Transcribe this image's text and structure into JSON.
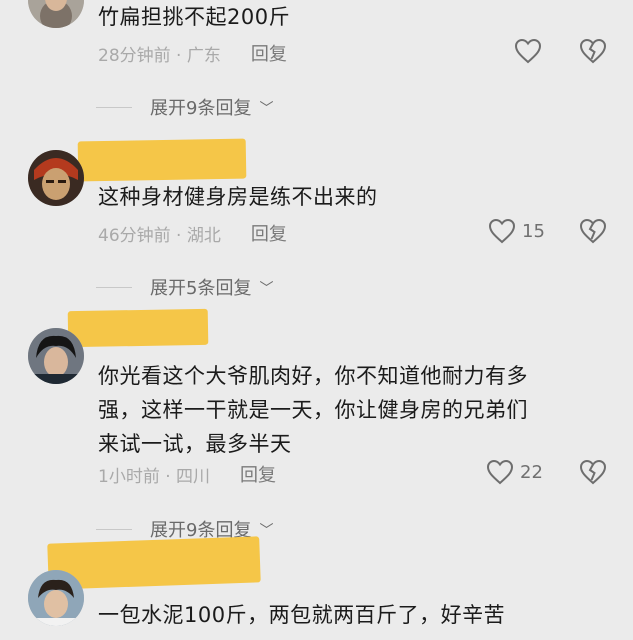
{
  "comments": [
    {
      "text": "竹扁担挑不起200斤",
      "time": "28分钟前 · 广东",
      "reply": "回复",
      "likes": "",
      "expand": "展开9条回复"
    },
    {
      "text": "这种身材健身房是练不出来的",
      "time": "46分钟前 · 湖北",
      "reply": "回复",
      "likes": "15",
      "expand": "展开5条回复"
    },
    {
      "text_lines": [
        "你光看这个大爷肌肉好，你不知道他耐力有多",
        "强，这样一干就是一天，你让健身房的兄弟们",
        "来试一试，最多半天"
      ],
      "time": "1小时前 · 四川",
      "reply": "回复",
      "likes": "22",
      "expand": "展开9条回复"
    },
    {
      "text": "一包水泥100斤，两包就两百斤了，好辛苦"
    }
  ],
  "colors": {
    "background": "#ebebeb",
    "name_highlight": "#f5c23a",
    "meta_text": "#a9a9a9"
  },
  "icons": [
    "heart-icon",
    "broken-heart-icon",
    "chevron-down-icon"
  ]
}
